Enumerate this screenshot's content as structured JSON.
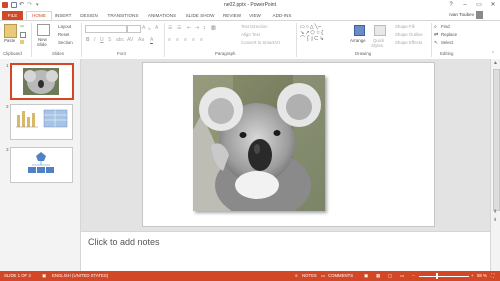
{
  "window": {
    "title": "ne02.pptx - PowerPoint",
    "user_name": "Ivan Toubev",
    "min_glyph": "–",
    "max_glyph": "▭",
    "close_glyph": "✕",
    "help_glyph": "?"
  },
  "tabs": [
    {
      "label": "FILE"
    },
    {
      "label": "HOME"
    },
    {
      "label": "INSERT"
    },
    {
      "label": "DESIGN"
    },
    {
      "label": "TRANSITIONS"
    },
    {
      "label": "ANIMATIONS"
    },
    {
      "label": "SLIDE SHOW"
    },
    {
      "label": "REVIEW"
    },
    {
      "label": "VIEW"
    },
    {
      "label": "ADD-INS"
    }
  ],
  "ribbon": {
    "clipboard": {
      "label": "Clipboard",
      "paste": "Paste"
    },
    "slides": {
      "label": "Slides",
      "new_slide_1": "New",
      "new_slide_2": "Slide",
      "layout": "Layout",
      "reset": "Reset",
      "section": "Section"
    },
    "font": {
      "label": "Font"
    },
    "paragraph": {
      "label": "Paragraph",
      "text_direction": "Text Direction",
      "align_text": "Align Text",
      "convert": "Convert to SmartArt"
    },
    "drawing": {
      "label": "Drawing",
      "arrange": "Arrange",
      "quick_1": "Quick",
      "quick_2": "Styles",
      "shape_fill": "Shape Fill",
      "shape_outline": "Shape Outline",
      "shape_effects": "Shape Effects"
    },
    "editing": {
      "label": "Editing",
      "find": "Find",
      "replace": "Replace",
      "select": "Select"
    }
  },
  "thumbnails": [
    {
      "number": "1"
    },
    {
      "number": "2"
    },
    {
      "number": "3"
    }
  ],
  "notes_placeholder": "Click to add notes",
  "status": {
    "slide": "SLIDE 1 OF 3",
    "language": "ENGLISH (UNITED STATES)",
    "notes": "NOTES",
    "comments": "COMMENTS",
    "zoom": "58 %"
  },
  "colors": {
    "accent": "#d24726",
    "ribbon_border": "#d6d6d6",
    "pane_bg": "#f3f3f3",
    "canvas_bg": "#e3e3e3"
  },
  "icons": [
    "save-icon",
    "undo-icon",
    "redo-icon",
    "paste-icon",
    "new-slide-icon",
    "bold-icon",
    "italic-icon",
    "underline-icon",
    "bullets-icon",
    "numbering-icon",
    "shapes-icon",
    "arrange-icon",
    "find-icon",
    "replace-icon",
    "select-icon",
    "notes-icon",
    "comments-icon",
    "normal-view-icon",
    "sorter-view-icon",
    "reading-view-icon",
    "slideshow-icon",
    "fit-slide-icon"
  ]
}
